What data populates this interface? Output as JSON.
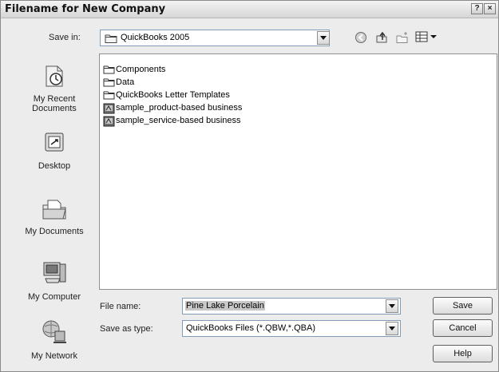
{
  "window": {
    "title": "Filename for New Company",
    "help_glyph": "?",
    "close_glyph": "×"
  },
  "toolbar": {
    "save_in_label": "Save in:",
    "save_in_value": "QuickBooks 2005",
    "icons": [
      "back-icon",
      "up-folder-icon",
      "new-folder-icon",
      "views-menu-icon"
    ]
  },
  "places": [
    {
      "label_line1": "My Recent",
      "label_line2": "Documents",
      "icon": "recent-documents-icon"
    },
    {
      "label_line1": "Desktop",
      "label_line2": "",
      "icon": "desktop-icon"
    },
    {
      "label_line1": "My Documents",
      "label_line2": "",
      "icon": "my-documents-icon"
    },
    {
      "label_line1": "My Computer",
      "label_line2": "",
      "icon": "my-computer-icon"
    },
    {
      "label_line1": "My Network",
      "label_line2": "",
      "icon": "my-network-icon"
    }
  ],
  "files": [
    {
      "name": "Components",
      "kind": "folder"
    },
    {
      "name": "Data",
      "kind": "folder"
    },
    {
      "name": "QuickBooks Letter Templates",
      "kind": "folder"
    },
    {
      "name": "sample_product-based business",
      "kind": "qb-file"
    },
    {
      "name": "sample_service-based business",
      "kind": "qb-file"
    }
  ],
  "form": {
    "file_name_label": "File name:",
    "file_name_value": "Pine Lake Porcelain",
    "save_as_type_label": "Save as type:",
    "save_as_type_value": "QuickBooks Files (*.QBW,*.QBA)"
  },
  "buttons": {
    "save": "Save",
    "cancel": "Cancel",
    "help": "Help"
  }
}
